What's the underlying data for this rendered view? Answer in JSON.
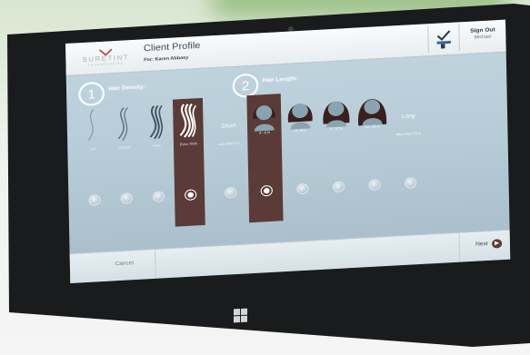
{
  "header": {
    "logo_name": "SURETINT",
    "logo_sub": "TECHNOLOGIES",
    "page_title": "Client Profile",
    "client_line": "For: Karen Abbasy",
    "signout_label": "Sign Out",
    "user_name": "Michael"
  },
  "step1": {
    "number": "1",
    "title": "Hair Density:",
    "options": [
      {
        "label": "Thin",
        "selected": false
      },
      {
        "label": "Normal",
        "selected": false
      },
      {
        "label": "Thick",
        "selected": false
      },
      {
        "label": "Extra Thick",
        "selected": true
      }
    ]
  },
  "step2": {
    "number": "2",
    "title": "Hair Length:",
    "short_word": "Short",
    "short_label": "Less than 3 in",
    "long_word": "Long",
    "long_label": "More than 15 in",
    "options": [
      {
        "label": "3 - 6 in",
        "selected": true
      },
      {
        "label": "6 - 9 in",
        "selected": false
      },
      {
        "label": "9 - 12 in",
        "selected": false
      },
      {
        "label": "12 - 15 in",
        "selected": false
      }
    ]
  },
  "footer": {
    "cancel_label": "Cancel",
    "next_label": "Next"
  },
  "colors": {
    "accent": "#5a3b38",
    "screen_bg": "#b5cbd6"
  },
  "icons": [
    "suretint-logo-icon",
    "checkmark-sign-icon",
    "next-arrow-icon",
    "windows-logo-icon",
    "camera-icon"
  ]
}
